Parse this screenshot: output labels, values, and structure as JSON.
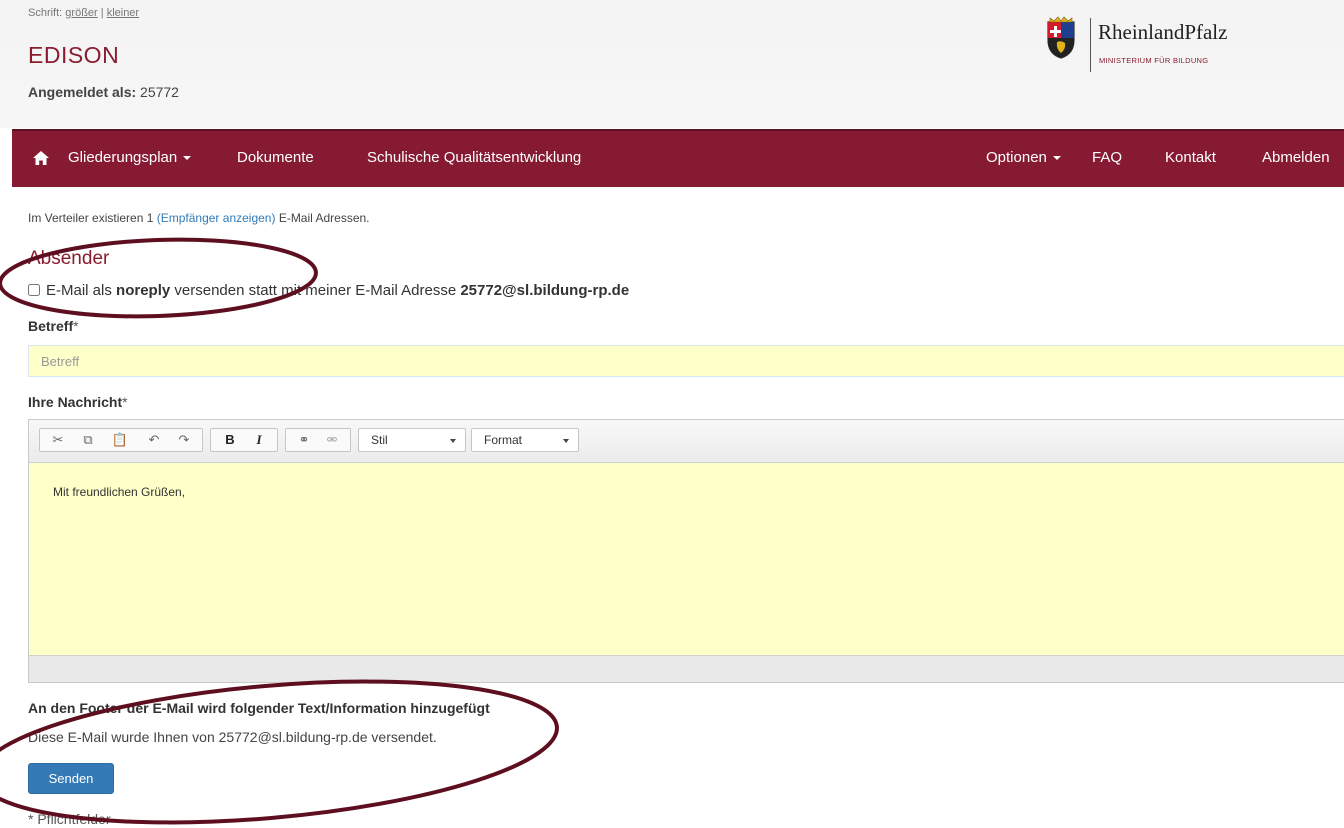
{
  "header": {
    "font_label": "Schrift:",
    "font_bigger": "größer",
    "font_separator": "|",
    "font_smaller": "kleiner",
    "app_title": "EDISON",
    "login_label": "Angemeldet als:",
    "login_user": "25772",
    "logo_name": "RheinlandPfalz",
    "logo_ministry": "MINISTERIUM FÜR BILDUNG"
  },
  "nav": {
    "home_icon": "home-icon",
    "items_left": [
      "Gliederungsplan",
      "Dokumente",
      "Schulische Qualitätsentwicklung"
    ],
    "items_right": [
      "Optionen",
      "FAQ",
      "Kontakt",
      "Abmelden"
    ]
  },
  "info": {
    "prefix": "Im Verteiler existieren 1",
    "link": "(Empfänger anzeigen)",
    "suffix": "E-Mail Adressen."
  },
  "sender": {
    "heading": "Absender",
    "checkbox_prefix": "E-Mail als",
    "checkbox_bold": "noreply",
    "checkbox_middle": "versenden statt mit meiner E-Mail Adresse",
    "checkbox_email": "25772@sl.bildung-rp.de",
    "checked": false
  },
  "subject": {
    "label": "Betreff",
    "required_mark": "*",
    "placeholder": "Betreff",
    "value": ""
  },
  "message": {
    "label": "Ihre Nachricht",
    "required_mark": "*",
    "style_combo": "Stil",
    "format_combo": "Format",
    "bold_label": "B",
    "italic_label": "I",
    "body": "Mit freundlichen Grüßen,",
    "toolbar_icons": [
      "cut-icon",
      "copy-icon",
      "paste-icon",
      "undo-icon",
      "redo-icon",
      "bold-icon",
      "italic-icon",
      "link-icon",
      "unlink-icon"
    ]
  },
  "footer_info": {
    "title": "An den Footer der E-Mail wird folgender Text/Information hinzugefügt",
    "text": "Diese E-Mail wurde Ihnen von 25772@sl.bildung-rp.de versendet."
  },
  "send_label": "Senden",
  "required_note": "* Pflichtfelder",
  "colors": {
    "brand": "#861a32",
    "title": "#8a1c2f",
    "primary_button": "#337ab7",
    "input_bg": "#ffffc9",
    "annotation": "#5e0f1f"
  }
}
